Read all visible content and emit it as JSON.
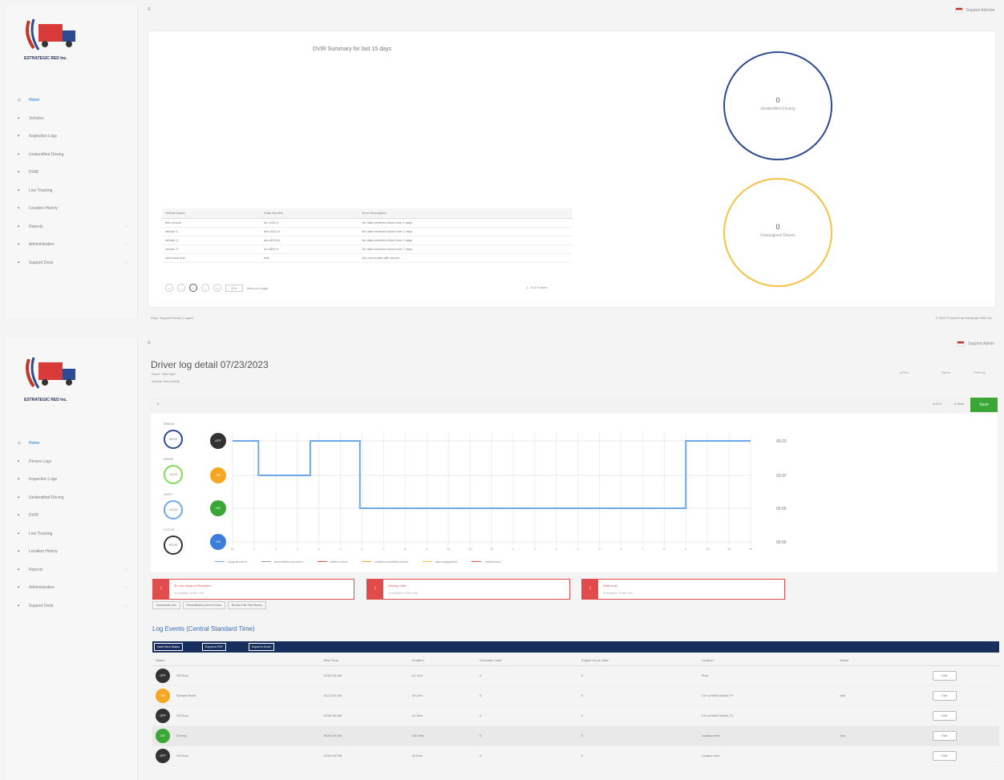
{
  "company_name": "ESTRATEGIC RED Inc.",
  "colors": {
    "navy": "#182e5c",
    "blue": "#2c4b93",
    "yellow": "#f5c242",
    "green": "#3aa635",
    "red": "#e24b4b",
    "line_blue": "#6fa8e6"
  },
  "top_screen": {
    "topbar": {
      "user": "Support Admin"
    },
    "nav": [
      {
        "icon": "home-icon",
        "glyph": "⌂",
        "label": "Home"
      },
      {
        "icon": "vehicles-icon",
        "glyph": "▪",
        "label": "Vehicles"
      },
      {
        "icon": "logs-icon",
        "glyph": "▪",
        "label": "Inspection Logs"
      },
      {
        "icon": "unidentified-icon",
        "glyph": "▪",
        "label": "Unidentified Driving"
      },
      {
        "icon": "dvir-icon",
        "glyph": "▪",
        "label": "DVIR"
      },
      {
        "icon": "tracking-icon",
        "glyph": "▪",
        "label": "Live Tracking"
      },
      {
        "icon": "location-icon",
        "glyph": "▪",
        "label": "Location History"
      },
      {
        "icon": "reports-icon",
        "glyph": "▪",
        "label": "Reports"
      },
      {
        "icon": "admin-icon",
        "glyph": "▪",
        "label": "Administration"
      },
      {
        "icon": "support-icon",
        "glyph": "▪",
        "label": "Support Desk"
      }
    ],
    "summary_title": "DVIR Summary for last 15 days",
    "circle_blue": {
      "value": "0",
      "label": "Unidentified Driving"
    },
    "circle_yellow": {
      "value": "0",
      "label": "Unassigned Drivers"
    },
    "table": {
      "headers": [
        "Vehicle Name",
        "Plate Number",
        "Error Description"
      ],
      "rows": [
        [
          "test vehicle",
          "tst-1234-4",
          "No data received since from 1 days"
        ],
        [
          "vehicle 1",
          "abc-4321-b",
          "No data received since from 1 days"
        ],
        [
          "vehicle 2",
          "abc-8910-b",
          "No data received since from 1 days"
        ],
        [
          "vehicle 3",
          "en-4567-b",
          "No data received since from 7 days"
        ],
        [
          "new truck test",
          "test",
          "Not connected with device"
        ]
      ],
      "pager_text": "items per page",
      "pager_count": "1 - 5 of 5 items"
    },
    "footer_left": "Help | Support Portal | Logout",
    "footer_right": "© 2023 Powered by Estrategic RED Inc."
  },
  "bottom_screen": {
    "topbar": {
      "user": "Support Admin"
    },
    "nav": [
      {
        "icon": "home-icon",
        "glyph": "⌂",
        "label": "Home"
      },
      {
        "icon": "vehicles-icon",
        "glyph": "▪",
        "label": "Drivers Logs"
      },
      {
        "icon": "logs-icon",
        "glyph": "▪",
        "label": "Inspection Logs"
      },
      {
        "icon": "unidentified-icon",
        "glyph": "▪",
        "label": "Unidentified Driving"
      },
      {
        "icon": "dvir-icon",
        "glyph": "▪",
        "label": "DVIR"
      },
      {
        "icon": "tracking-icon",
        "glyph": "▪",
        "label": "Live Tracking"
      },
      {
        "icon": "location-icon",
        "glyph": "▪",
        "label": "Location History"
      },
      {
        "icon": "reports-icon",
        "glyph": "▪",
        "label": "Reports"
      },
      {
        "icon": "admin-icon",
        "glyph": "▪",
        "label": "Administration"
      },
      {
        "icon": "support-icon",
        "glyph": "▪",
        "label": "Support Desk"
      }
    ],
    "page_title": "Driver log detail 07/23/2023",
    "sub1": "Driver: Test Start",
    "sub2": "Vehicle: test vehicle",
    "header_right": [
      "◂ Prev",
      "Next ▸",
      "Print log"
    ],
    "toolbar": {
      "t1": "◂ 24 h",
      "t2": "▸ Next",
      "save": "Save"
    },
    "stats": [
      {
        "label": "BREAK",
        "value": "08:00",
        "color": "#2c4b93"
      },
      {
        "label": "DRIVE",
        "value": "11:00",
        "color": "#7ed957"
      },
      {
        "label": "SHIFT",
        "value": "14:00",
        "color": "#6fa8e6"
      },
      {
        "label": "CYCLE",
        "value": "60:00",
        "color": "#333333"
      }
    ],
    "status_dots": [
      {
        "code": "OFF",
        "color": "#333333"
      },
      {
        "code": "SB",
        "color": "#f5a623"
      },
      {
        "code": "DR",
        "color": "#3aa635"
      },
      {
        "code": "ON",
        "color": "#3b7dd8"
      }
    ],
    "chart_data": {
      "type": "line",
      "rows": [
        "OFF",
        "SB",
        "DR",
        "ON"
      ],
      "steps": [
        {
          "t": 0.0,
          "status": "OFF"
        },
        {
          "t": 1.2,
          "status": "SB"
        },
        {
          "t": 3.6,
          "status": "OFF"
        },
        {
          "t": 5.9,
          "status": "DR"
        },
        {
          "t": 21.0,
          "status": "OFF"
        },
        {
          "t": 24.0,
          "status": "OFF"
        }
      ],
      "totals": [
        "09:23",
        "03:37",
        "05:00",
        "00:00"
      ],
      "xlim": [
        0,
        24
      ],
      "grid": true
    },
    "legend": [
      {
        "label": "original event",
        "color": "#6fa8e6"
      },
      {
        "label": "uncertified log event",
        "color": "#999999"
      },
      {
        "label": "edited event",
        "color": "#e24b4b"
      },
      {
        "label": "edited uncertified event",
        "color": "#f5a623"
      },
      {
        "label": "auto-suggested",
        "color": "#f5c242"
      },
      {
        "label": "malfunction",
        "color": "#e24b4b"
      }
    ],
    "alerts": [
      {
        "title": "30 min. break is Required",
        "sub": "A violation of the rule"
      },
      {
        "title": "Driving Limit",
        "sub": "A violation of the rule"
      },
      {
        "title": "Shift Limit",
        "sub": "A violation of the rule"
      }
    ],
    "pill_buttons": [
      "Documents Info",
      "Recertification Driver's Data",
      "Review Edit Trail History"
    ],
    "log_title": "Log Events (Central Standard Time)",
    "navy_buttons": [
      "Insert New Status",
      "Export to PDF",
      "Export to Excel"
    ],
    "events": {
      "headers": [
        "Status",
        "Start Time",
        "Duration",
        "Odometer Start",
        "Engine Hours Start",
        "Location",
        "Notes",
        ""
      ],
      "rows": [
        {
          "code": "OFF",
          "color": "#333333",
          "status": "Off Duty",
          "start": "12:00:00 AM",
          "duration": "1h 12m",
          "odometer": "0",
          "engine": "0",
          "location": "Start",
          "notes": "",
          "action": "Edit"
        },
        {
          "code": "SB",
          "color": "#f5a623",
          "status": "Sleeper Berth",
          "start": "01:12:00 AM",
          "duration": "2h 24m",
          "odometer": "0",
          "engine": "0",
          "location": "0.5 mi NNW Miami, FL",
          "notes": "test",
          "action": "Edit"
        },
        {
          "code": "OFF",
          "color": "#333333",
          "status": "Off Duty",
          "start": "03:36:00 AM",
          "duration": "2h 18m",
          "odometer": "0",
          "engine": "0",
          "location": "0.5 mi NNW Miami, FL",
          "notes": "",
          "action": "Edit"
        },
        {
          "code": "DR",
          "color": "#3aa635",
          "status": "Driving",
          "start": "05:54:00 AM",
          "duration": "15h 06m",
          "odometer": "0",
          "engine": "0",
          "location": "Location test",
          "notes": "test",
          "action": "Edit"
        },
        {
          "code": "OFF",
          "color": "#333333",
          "status": "Off Duty",
          "start": "09:00:00 PM",
          "duration": "3h 00m",
          "odometer": "0",
          "engine": "0",
          "location": "Location test",
          "notes": "",
          "action": "Edit"
        }
      ]
    }
  }
}
